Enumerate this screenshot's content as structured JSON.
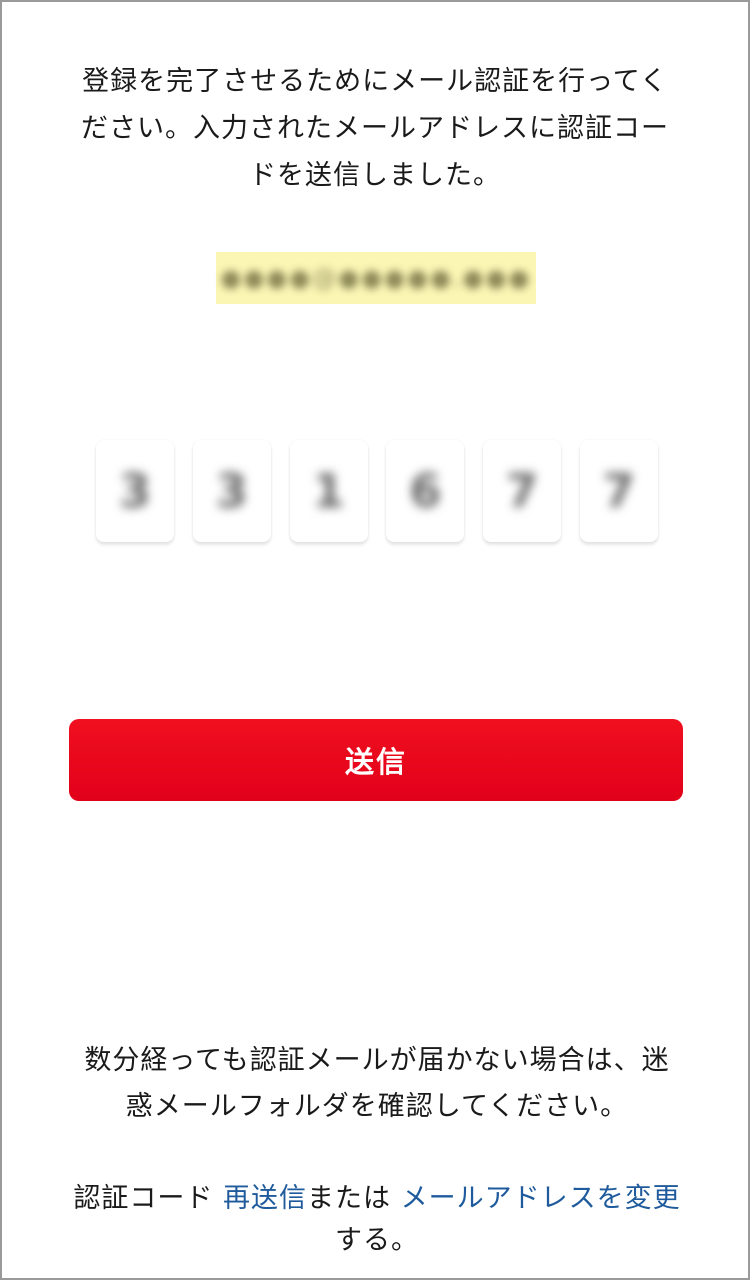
{
  "intro": {
    "line1": "登録を完了させるためにメール認証を行ってく",
    "line2": "ださい。入力されたメールアドレスに認証コー",
    "line3": "ドを送信しました。"
  },
  "email": {
    "masked_text": "●●●●@●●●●●.●●●"
  },
  "code": {
    "digits": [
      "3",
      "3",
      "1",
      "6",
      "7",
      "7"
    ]
  },
  "send_button": {
    "label": "送信",
    "color": "#e60012"
  },
  "notice": {
    "line1": "数分経っても認証メールが届かない場合は、迷",
    "line2": "惑メールフォルダを確認してください。"
  },
  "footer": {
    "prefix": "認証コード ",
    "resend_link": "再送信",
    "middle": "または ",
    "change_email_link": "メールアドレスを変更",
    "suffix": "する。"
  },
  "colors": {
    "accent": "#e60012",
    "link": "#1f5b9c",
    "highlight": "#fbf6b4"
  }
}
